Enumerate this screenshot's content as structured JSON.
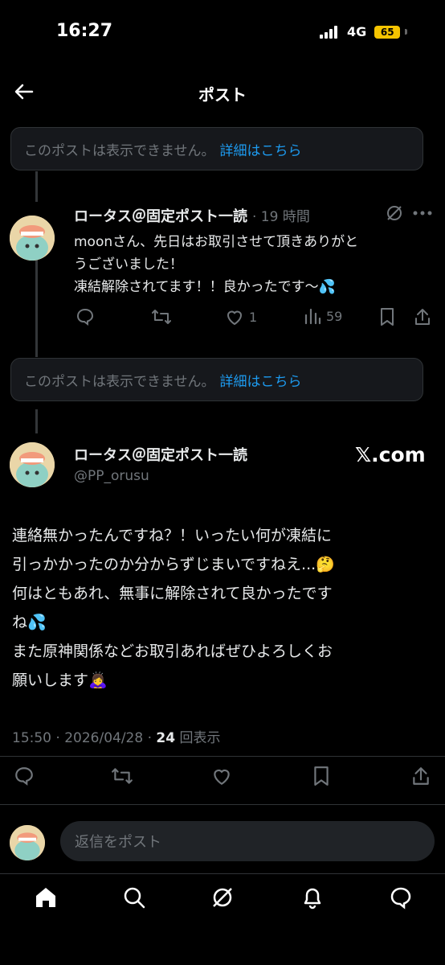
{
  "status_bar": {
    "time": "16:27",
    "network": "4G",
    "battery": "65"
  },
  "header": {
    "title": "ポスト"
  },
  "unavailable_notice": {
    "text": "このポストは表示できません。",
    "link": "詳細はこちら"
  },
  "reply_tweet": {
    "name": "ロータス＠固定ポスト一読",
    "time": "· 19 時間",
    "lines": [
      "moonさん、先日はお取引させて頂きありがと",
      "うございました！",
      "凍結解除されてます！！良かったです〜💦"
    ],
    "stats": {
      "likes": "1",
      "views": "59"
    }
  },
  "main_tweet": {
    "name": "ロータス＠固定ポスト一読",
    "handle": "@PP_orusu",
    "lines": [
      "連絡無かったんですね？！いったい何が凍結に",
      "引っかかったのか分からずじまいですねえ...🤔",
      "何はともあれ、無事に解除されて良かったです",
      "ね💦",
      "また原神関係などお取引あればぜひよろしくお",
      "願いします🙇‍♀️"
    ],
    "date": "15:50 · 2026/04/28 · ",
    "views_count": "24",
    "views_label": " 回表示"
  },
  "watermark": "𝕏.com",
  "reply_input": {
    "placeholder": "返信をポスト"
  },
  "colors": {
    "background": "#000000",
    "link": "#1d9bf0",
    "muted": "#71767b",
    "text": "#e7e9ea"
  }
}
